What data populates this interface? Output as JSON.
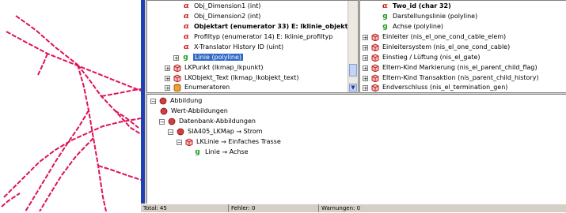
{
  "colors": {
    "map_lines": "#e0105a",
    "selection": "#316ac5",
    "frame_blue": "#1f3fb5",
    "app_bg": "#d4d0c8"
  },
  "tree_left": {
    "items": [
      {
        "icon": "alpha-icon",
        "label": "Obj_Dimension1  (int)"
      },
      {
        "icon": "alpha-icon",
        "label": "Obj_Dimension2  (int)"
      },
      {
        "icon": "alpha-icon",
        "label": "Objektart  (enumerator 33)  E: lklinie_objektart"
      },
      {
        "icon": "alpha-icon",
        "label": "Profiltyp  (enumerator 14)  E: lklinie_profiltyp"
      },
      {
        "icon": "alpha-icon",
        "label": "X-Translator History ID  (uint)"
      },
      {
        "icon": "geometry-icon",
        "label": "Linie  (polyline)"
      },
      {
        "icon": "cube-icon",
        "label": "LKPunkt  (lkmap_lkpunkt)"
      },
      {
        "icon": "cube-icon",
        "label": "LKObjekt_Text  (lkmap_lkobjekt_text)"
      },
      {
        "icon": "database-icon",
        "label": "Enumeratoren"
      }
    ]
  },
  "tree_right": {
    "items": [
      {
        "icon": "alpha-icon",
        "label": "Two_id  (char 32)"
      },
      {
        "icon": "geometry-icon",
        "label": "Darstellungslinie  (polyline)"
      },
      {
        "icon": "geometry-icon",
        "label": "Achse  (polyline)"
      },
      {
        "icon": "cube-icon",
        "label": "Einleiter  (nis_el_one_cond_cable_elem)"
      },
      {
        "icon": "cube-icon",
        "label": "Einleitersystem  (nis_el_one_cond_cable)"
      },
      {
        "icon": "cube-icon",
        "label": "Einstieg / Lüftung  (nis_el_gate)"
      },
      {
        "icon": "cube-icon",
        "label": "Eltern-Kind Markierung  (nis_el_parent_child_flag)"
      },
      {
        "icon": "cube-icon",
        "label": "Eltern-Kind Transaktion  (nis_parent_child_history)"
      },
      {
        "icon": "cube-icon",
        "label": "Endverschluss  (nis_el_termination_gen)"
      }
    ]
  },
  "mapping_tree": {
    "root": "Abbildung",
    "value_mappings": "Wert-Abbildungen",
    "db_mappings": "Datenbank-Abbildungen",
    "sia_source": "SIA405_LKMap",
    "sia_target": "Strom",
    "lklinie_source": "LKLinie",
    "lklinie_target": "Einfaches Trasse",
    "linie_source": "Linie",
    "linie_target": "Achse"
  },
  "status_bar": {
    "total": "Total: 45",
    "errors": "Fehler: 0",
    "warnings": "Warnungen: 0"
  }
}
